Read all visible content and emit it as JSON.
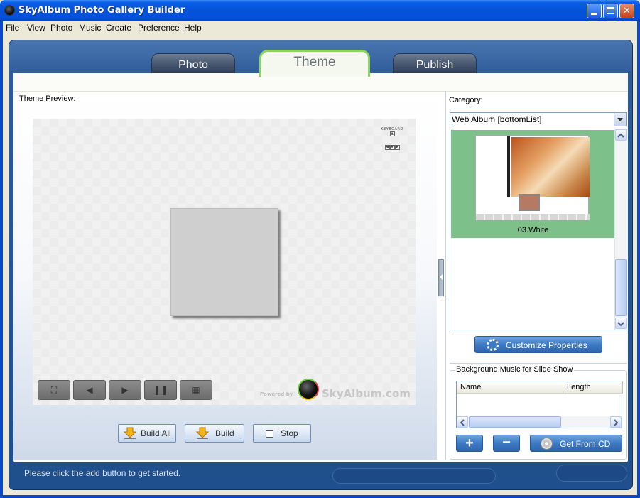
{
  "window": {
    "title": "SkyAlbum Photo Gallery Builder",
    "minimize_icon": "minimize-icon",
    "maximize_icon": "maximize-icon",
    "close_icon": "close-icon",
    "close_glyph": "✕"
  },
  "menu": [
    "File",
    "View",
    "Photo",
    "Music",
    "Create",
    "Preference",
    "Help"
  ],
  "tabs": {
    "photo": "Photo",
    "theme": "Theme",
    "publish": "Publish",
    "active": "theme",
    "active_color": "#8cd45e"
  },
  "preview": {
    "label": "Theme Preview:",
    "keyboard_label": "KEYBOARD",
    "keys": [
      "▲",
      "◀",
      "▼",
      "▶"
    ],
    "controls": [
      {
        "name": "fullscreen-icon",
        "glyph": "⛶"
      },
      {
        "name": "previous-icon",
        "glyph": "◀"
      },
      {
        "name": "next-icon",
        "glyph": "▶"
      },
      {
        "name": "pause-icon",
        "glyph": "❚❚"
      },
      {
        "name": "thumbnails-icon",
        "glyph": "▦"
      }
    ],
    "powered_by": "Powered by",
    "brand": "SkyAlbum.com"
  },
  "build": {
    "build_all": "Build All",
    "build": "Build",
    "stop": "Stop"
  },
  "category": {
    "label": "Category:",
    "selected": "Web Album [bottomList]"
  },
  "theme_list": {
    "items": [
      {
        "label": "03.White",
        "selected": true,
        "highlight_color": "#7ec089"
      }
    ]
  },
  "customize_label": "Customize Properties",
  "music": {
    "title": "Background Music for Slide Show",
    "columns": [
      "Name",
      "Length"
    ],
    "rows": [],
    "add_glyph": "+",
    "remove_glyph": "−",
    "get_cd_label": "Get From CD"
  },
  "status": {
    "text": "Please click the add button to get started."
  }
}
